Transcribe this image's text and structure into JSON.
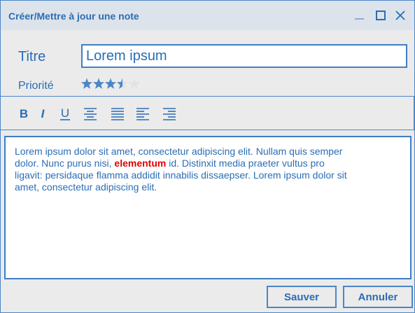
{
  "window": {
    "title": "Créer/Mettre à jour une note"
  },
  "form": {
    "title_label": "Titre",
    "title_value": "Lorem ipsum",
    "priority_label": "Priorité",
    "priority_rating": 3.5,
    "priority_max": 5
  },
  "toolbar": {
    "bold_label": "B",
    "italic_label": "I",
    "underline_label": "U",
    "icons": [
      "bold-icon",
      "italic-icon",
      "underline-icon",
      "align-center-icon",
      "align-justify-icon",
      "align-left-icon",
      "align-right-icon"
    ]
  },
  "editor": {
    "text_before": "Lorem ipsum dolor sit amet, consectetur adipiscing elit. Nullam quis semper dolor. Nunc purus nisi, ",
    "highlight": "elementum",
    "text_after": " id. Distinxit  media praeter vultus pro ligavit: persidaque flamma addidit innabilis dissaepser. Lorem ipsum dolor sit amet, consectetur adipiscing elit."
  },
  "buttons": {
    "save": "Sauver",
    "cancel": "Annuler"
  },
  "colors": {
    "accent": "#2a6db5",
    "border": "#4a86c8",
    "highlight": "#e00000",
    "star_filled": "#4a86c8",
    "star_empty": "#e2e2e2"
  }
}
